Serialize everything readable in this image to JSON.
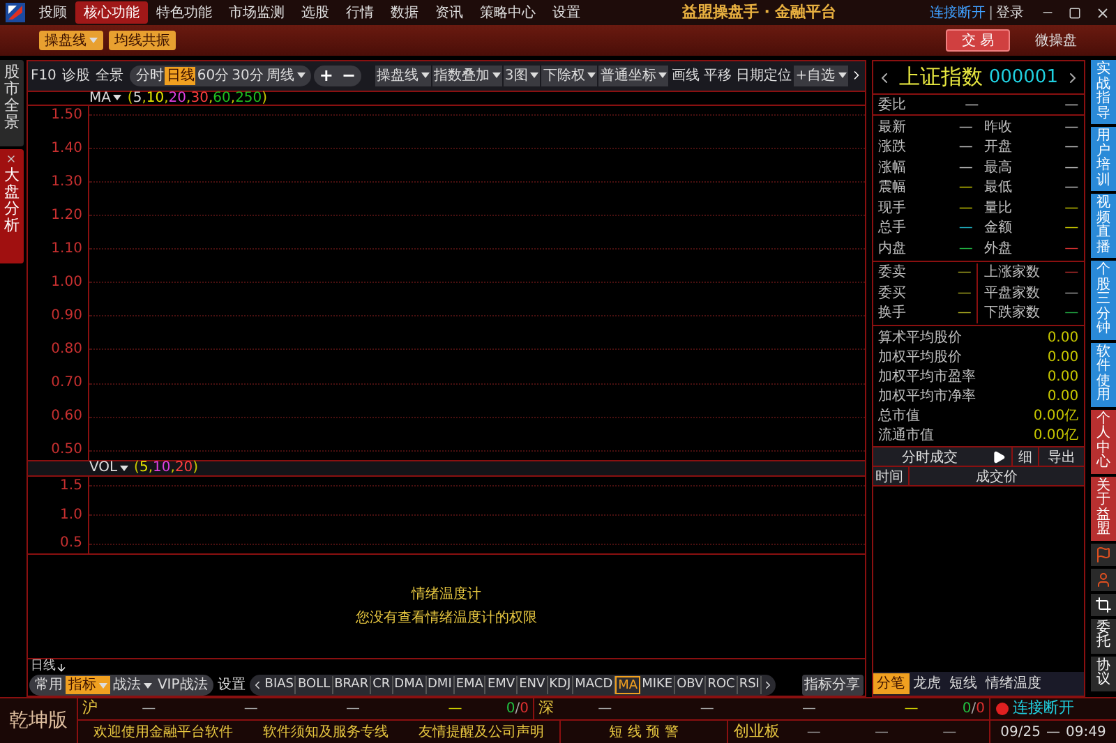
{
  "menu": [
    {
      "label": "投顾",
      "selected": false
    },
    {
      "label": "核心功能",
      "selected": true
    },
    {
      "label": "特色功能",
      "selected": false
    },
    {
      "label": "市场监测",
      "selected": false
    },
    {
      "label": "选股",
      "selected": false
    },
    {
      "label": "行情",
      "selected": false
    },
    {
      "label": "数据",
      "selected": false
    },
    {
      "label": "资讯",
      "selected": false
    },
    {
      "label": "策略中心",
      "selected": false
    },
    {
      "label": "设置",
      "selected": false
    }
  ],
  "app_title": "益盟操盘手 · 金融平台",
  "connection": "连接断开",
  "login": "登录",
  "login_separator": "|",
  "toolbar_buttons": [
    {
      "label": "操盘线",
      "dropdown": true
    },
    {
      "label": "均线共振",
      "dropdown": false
    }
  ],
  "trade_button": "交 易",
  "micro_button": "微操盘",
  "left_tabs": [
    {
      "label": "股市全景",
      "selected": false,
      "closable": false
    },
    {
      "label": "大盘分析",
      "selected": true,
      "closable": true
    }
  ],
  "chart_toolbar": {
    "left": [
      "F10",
      "诊股",
      "全景"
    ],
    "periods": [
      {
        "label": "分时",
        "selected": false,
        "dropdown": false
      },
      {
        "label": "日线",
        "selected": true,
        "dropdown": false
      },
      {
        "label": "60分",
        "selected": false,
        "dropdown": false
      },
      {
        "label": "30分",
        "selected": false,
        "dropdown": false
      },
      {
        "label": "周线",
        "selected": false,
        "dropdown": true
      }
    ],
    "zoom": [
      "+",
      "−"
    ],
    "right": [
      {
        "label": "操盘线",
        "dropdown": true
      },
      {
        "label": "指数叠加",
        "dropdown": true
      },
      {
        "label": "3图",
        "dropdown": true
      },
      {
        "label": "下除权",
        "dropdown": true
      },
      {
        "label": "普通坐标",
        "dropdown": true
      },
      {
        "label": "画线",
        "dropdown": false
      },
      {
        "label": "平移",
        "dropdown": false
      },
      {
        "label": "日期定位",
        "dropdown": false
      },
      {
        "label": "+自选",
        "dropdown": true
      }
    ]
  },
  "ma_legend": {
    "label": "MA",
    "open": "(",
    "close": ")",
    "separator": ",",
    "params": [
      {
        "text": "5",
        "color": "#d8d8d8"
      },
      {
        "text": "10",
        "color": "#e8e800"
      },
      {
        "text": "20",
        "color": "#e040e0"
      },
      {
        "text": "30",
        "color": "#ff4040"
      },
      {
        "text": "60",
        "color": "#20c020"
      },
      {
        "text": "250",
        "color": "#20c020"
      }
    ]
  },
  "price_axis": [
    "1.50",
    "1.40",
    "1.30",
    "1.20",
    "1.10",
    "1.00",
    "0.90",
    "0.80",
    "0.70",
    "0.60",
    "0.50"
  ],
  "vol_legend": {
    "label": "VOL",
    "open": "(",
    "close": ")",
    "separator": ",",
    "params": [
      {
        "text": "5",
        "color": "#e8e800"
      },
      {
        "text": "10",
        "color": "#e040e0"
      },
      {
        "text": "20",
        "color": "#ff4040"
      }
    ]
  },
  "volume_axis": [
    "1.5",
    "1.0",
    "0.5"
  ],
  "notice": {
    "title": "情绪温度计",
    "message": "您没有查看情绪温度计的权限"
  },
  "period_label": "日线",
  "indicator_groups": [
    {
      "label": "常用",
      "selected": false,
      "dropdown": false
    },
    {
      "label": "指标",
      "selected": true,
      "dropdown": true
    },
    {
      "label": "战法",
      "selected": false,
      "dropdown": true
    },
    {
      "label": "VIP战法",
      "selected": false,
      "dropdown": false
    }
  ],
  "settings": "设置",
  "indicators": [
    {
      "label": "BIAS",
      "selected": false
    },
    {
      "label": "BOLL",
      "selected": false
    },
    {
      "label": "BRAR",
      "selected": false
    },
    {
      "label": "CR",
      "selected": false
    },
    {
      "label": "DMA",
      "selected": false
    },
    {
      "label": "DMI",
      "selected": false
    },
    {
      "label": "EMA",
      "selected": false
    },
    {
      "label": "EMV",
      "selected": false
    },
    {
      "label": "ENV",
      "selected": false
    },
    {
      "label": "KDJ",
      "selected": false
    },
    {
      "label": "MACD",
      "selected": false
    },
    {
      "label": "MA",
      "selected": true
    },
    {
      "label": "MIKE",
      "selected": false
    },
    {
      "label": "OBV",
      "selected": false
    },
    {
      "label": "ROC",
      "selected": false
    },
    {
      "label": "RSI",
      "selected": false
    }
  ],
  "indicator_share": "指标分享",
  "quote": {
    "name": "上证指数",
    "code": "000001",
    "ratio": {
      "label": "委比",
      "value": "—",
      "value2": "—"
    },
    "rows": [
      {
        "left": {
          "label": "最新",
          "value": "—",
          "color": "#c0c0c0"
        },
        "right": {
          "label": "昨收",
          "value": "—",
          "color": "#c0c0c0"
        }
      },
      {
        "left": {
          "label": "涨跌",
          "value": "—",
          "color": "#c0c0c0"
        },
        "right": {
          "label": "开盘",
          "value": "—",
          "color": "#c0c0c0"
        }
      },
      {
        "left": {
          "label": "涨幅",
          "value": "—",
          "color": "#c0c0c0"
        },
        "right": {
          "label": "最高",
          "value": "—",
          "color": "#c0c0c0"
        }
      },
      {
        "left": {
          "label": "震幅",
          "value": "—",
          "color": "#c8c800"
        },
        "right": {
          "label": "最低",
          "value": "—",
          "color": "#c0c0c0"
        }
      },
      {
        "left": {
          "label": "现手",
          "value": "—",
          "color": "#c8c800"
        },
        "right": {
          "label": "量比",
          "value": "—",
          "color": "#c8c800"
        }
      },
      {
        "left": {
          "label": "总手",
          "value": "—",
          "color": "#20b0c0"
        },
        "right": {
          "label": "金额",
          "value": "—",
          "color": "#c8c800"
        }
      },
      {
        "left": {
          "label": "内盘",
          "value": "—",
          "color": "#20b040"
        },
        "right": {
          "label": "外盘",
          "value": "—",
          "color": "#d03030"
        }
      }
    ],
    "orders": [
      {
        "left": {
          "label": "委卖",
          "value": "—",
          "color": "#a8a820"
        },
        "right": {
          "label": "上涨家数",
          "value": "—",
          "color": "#c03030"
        }
      },
      {
        "left": {
          "label": "委买",
          "value": "—",
          "color": "#a8a820"
        },
        "right": {
          "label": "平盘家数",
          "value": "—",
          "color": "#a0a0a0"
        }
      },
      {
        "left": {
          "label": "换手",
          "value": "—",
          "color": "#a8a820"
        },
        "right": {
          "label": "下跌家数",
          "value": "—",
          "color": "#20a040"
        }
      }
    ],
    "stats": [
      {
        "label": "算术平均股价",
        "value": "0.00"
      },
      {
        "label": "加权平均股价",
        "value": "0.00"
      },
      {
        "label": "加权平均市盈率",
        "value": "0.00"
      },
      {
        "label": "加权平均市净率",
        "value": "0.00"
      },
      {
        "label": "总市值",
        "value": "0.00亿"
      },
      {
        "label": "流通市值",
        "value": "0.00亿"
      }
    ]
  },
  "trades": {
    "title": "分时成交",
    "detail": "细",
    "export": "导出",
    "columns": [
      "时间",
      "成交价"
    ]
  },
  "bottom_tabs": [
    {
      "label": "分笔",
      "selected": true
    },
    {
      "label": "龙虎",
      "selected": false
    },
    {
      "label": "短线",
      "selected": false
    },
    {
      "label": "情绪温度",
      "selected": false
    }
  ],
  "side_tabs": [
    {
      "kind": "tab",
      "label": "实战指导",
      "color": "#2a8ad8"
    },
    {
      "kind": "tab",
      "label": "用户培训",
      "color": "#2a8ad8"
    },
    {
      "kind": "tab",
      "label": "视频直播",
      "color": "#2a8ad8"
    },
    {
      "kind": "tab",
      "label": "个股三分钟",
      "color": "#2a8ad8"
    },
    {
      "kind": "tab",
      "label": "软件使用",
      "color": "#2a8ad8"
    },
    {
      "kind": "tab",
      "label": "个人中心",
      "color": "#b83030"
    },
    {
      "kind": "tab",
      "label": "关于益盟",
      "color": "#b83030"
    },
    {
      "kind": "icon"
    },
    {
      "kind": "icon"
    },
    {
      "kind": "icon"
    },
    {
      "kind": "tab",
      "label": "委托",
      "color": "#2a2a2a"
    },
    {
      "kind": "tab",
      "label": "协议",
      "color": "#2a2a2a"
    }
  ],
  "status": {
    "edition": "乾坤版",
    "markets": [
      {
        "name": "沪",
        "values": [
          {
            "text": "—",
            "color": "#a0a0a0"
          },
          {
            "text": "—",
            "color": "#a0a0a0"
          },
          {
            "text": "—",
            "color": "#a0a0a0"
          },
          {
            "text": "—",
            "color": "#c8c800"
          }
        ],
        "up": "0",
        "separator": "/",
        "down": "0"
      },
      {
        "name": "深",
        "values": [
          {
            "text": "—",
            "color": "#a0a0a0"
          },
          {
            "text": "—",
            "color": "#a0a0a0"
          },
          {
            "text": "—",
            "color": "#a0a0a0"
          },
          {
            "text": "—",
            "color": "#c8c800"
          }
        ],
        "up": "0",
        "separator": "/",
        "down": "0"
      }
    ],
    "connection": "连接断开",
    "messages": [
      "欢迎使用金融平台软件",
      "软件须知及服务专线",
      "友情提醒及公司声明"
    ],
    "alert": "短 线 预 警",
    "board": {
      "name": "创业板",
      "values": [
        "—",
        "—",
        "—"
      ]
    },
    "date": "09/25",
    "date_separator": "—",
    "time": "09:49"
  }
}
